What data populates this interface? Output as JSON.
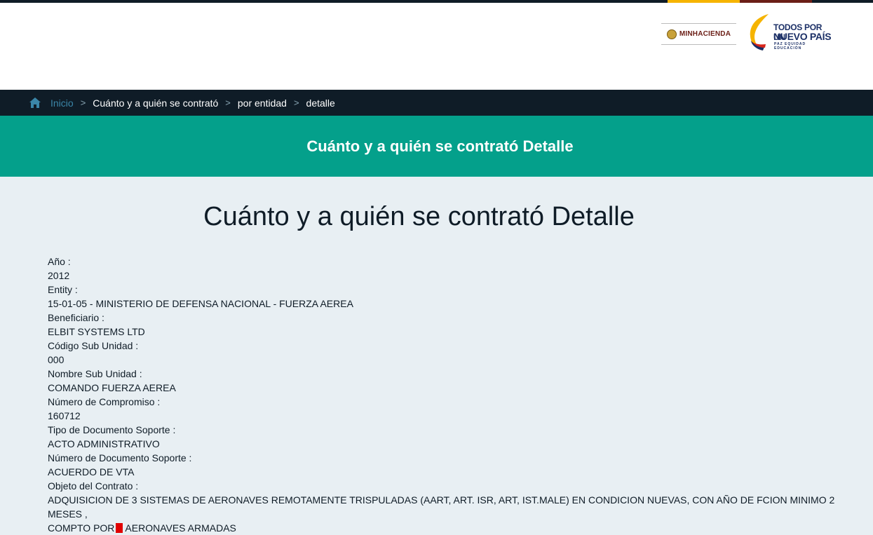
{
  "colors": {
    "top_bar": "#0f1c27",
    "accent_yellow": "#f6b400",
    "accent_brown": "#6b1e16",
    "banner": "#04a08b",
    "breadcrumb_bg": "#0f1c27",
    "page_bg": "#e8eff3"
  },
  "header": {
    "minhacienda_label": "MINHACIENDA",
    "logo_line1": "TODOS POR UN",
    "logo_line2": "NUEVO PAÍS",
    "logo_line3": "PAZ  EQUIDAD  EDUCACIÓN"
  },
  "breadcrumb": {
    "home_icon": "home-icon",
    "items": [
      "Inicio",
      "Cuánto y a quién se contrató",
      "por entidad",
      "detalle"
    ],
    "separator": ">"
  },
  "banner": {
    "title": "Cuánto y a quién se contrató Detalle"
  },
  "main": {
    "title": "Cuánto y a quién se contrató Detalle",
    "fields": [
      {
        "label": "Año :",
        "value": "2012"
      },
      {
        "label": "Entity :",
        "value": "15-01-05 - MINISTERIO DE DEFENSA NACIONAL - FUERZA AEREA"
      },
      {
        "label": "Beneficiario :",
        "value": "ELBIT SYSTEMS LTD"
      },
      {
        "label": "Código Sub Unidad :",
        "value": "000"
      },
      {
        "label": "Nombre Sub Unidad :",
        "value": "COMANDO FUERZA AEREA"
      },
      {
        "label": "Número de Compromiso :",
        "value": "160712"
      },
      {
        "label": "Tipo de Documento Soporte :",
        "value": "ACTO ADMINISTRATIVO"
      },
      {
        "label": "Número de Documento Soporte :",
        "value": "ACUERDO DE VTA"
      },
      {
        "label": "Objeto del Contrato :",
        "value_line1": "ADQUISICION DE 3 SISTEMAS DE AERONAVES REMOTAMENTE TRISPULADAS (AART, ART. ISR, ART, IST.MALE) EN CONDICION NUEVAS, CON AÑO DE FCION MINIMO 2 MESES ,",
        "value_line2_before": "COMPTO POR",
        "value_line2_after": "AERONAVES ARMADAS"
      }
    ]
  }
}
